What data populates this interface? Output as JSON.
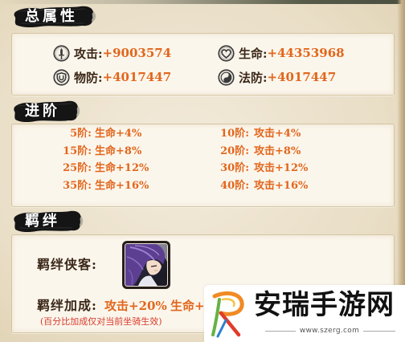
{
  "total_attributes": {
    "title": "总属性",
    "stats": [
      {
        "icon": "sword-icon",
        "label": "攻击:",
        "value": "+9003574"
      },
      {
        "icon": "heart-icon",
        "label": "生命:",
        "value": "+44353968"
      },
      {
        "icon": "shield-icon",
        "label": "物防:",
        "value": "+4017447"
      },
      {
        "icon": "yin-yang-icon",
        "label": "法防:",
        "value": "+4017447"
      }
    ]
  },
  "advancement": {
    "title": "进阶",
    "rows": [
      {
        "left": {
          "tier": "5阶:",
          "bonus": "生命+4%"
        },
        "right": {
          "tier": "10阶:",
          "bonus": "攻击+4%"
        }
      },
      {
        "left": {
          "tier": "15阶:",
          "bonus": "生命+8%"
        },
        "right": {
          "tier": "20阶:",
          "bonus": "攻击+8%"
        }
      },
      {
        "left": {
          "tier": "25阶:",
          "bonus": "生命+12%"
        },
        "right": {
          "tier": "30阶:",
          "bonus": "攻击+12%"
        }
      },
      {
        "left": {
          "tier": "35阶:",
          "bonus": "生命+16%"
        },
        "right": {
          "tier": "40阶:",
          "bonus": "攻击+16%"
        }
      }
    ]
  },
  "bond": {
    "title": "羁绊",
    "hero_label": "羁绊侠客:",
    "bonus_label": "羁绊加成:",
    "bonuses": [
      "攻击+20%",
      "生命+2"
    ],
    "note": "(百分比加成仅对当前坐骑生效)"
  },
  "watermark": {
    "logo_icon": "anrui-logo-icon",
    "name": "安瑞手游网",
    "url": "www.szerg.com"
  },
  "colors": {
    "value_orange": "#e2661c",
    "label_dark": "#3a2718",
    "note_red": "#d9392a",
    "panel_bg": "#fbf6ec",
    "header_ink": "#151515"
  }
}
